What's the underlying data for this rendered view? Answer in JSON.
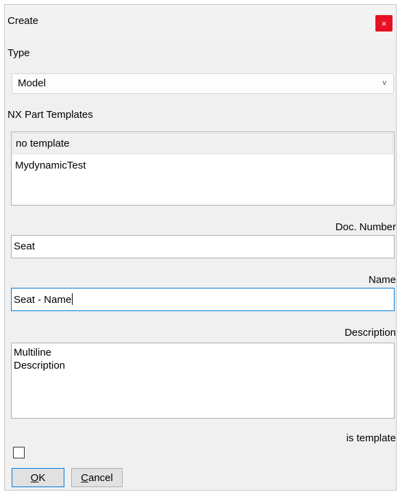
{
  "window": {
    "title": "Create",
    "close_glyph": "×"
  },
  "type_section": {
    "label": "Type",
    "selected_value": "Model",
    "chevron_glyph": "v"
  },
  "templates_section": {
    "label": "NX Part Templates",
    "items": [
      "no template",
      "MydynamicTest"
    ],
    "selected_index": 0
  },
  "doc_number": {
    "label": "Doc. Number",
    "value": "Seat"
  },
  "name": {
    "label": "Name",
    "value": "Seat - Name"
  },
  "description": {
    "label": "Description",
    "value": "Multiline\nDescription"
  },
  "is_template": {
    "label": "is template",
    "checked": false
  },
  "buttons": {
    "ok": {
      "accel": "O",
      "rest": "K"
    },
    "cancel": {
      "accel": "C",
      "rest": "ancel"
    }
  },
  "colors": {
    "close": "#e81123",
    "focus": "#0078d7"
  },
  "icons": {
    "close": "close-icon",
    "dropdown": "chevron-down-icon"
  }
}
